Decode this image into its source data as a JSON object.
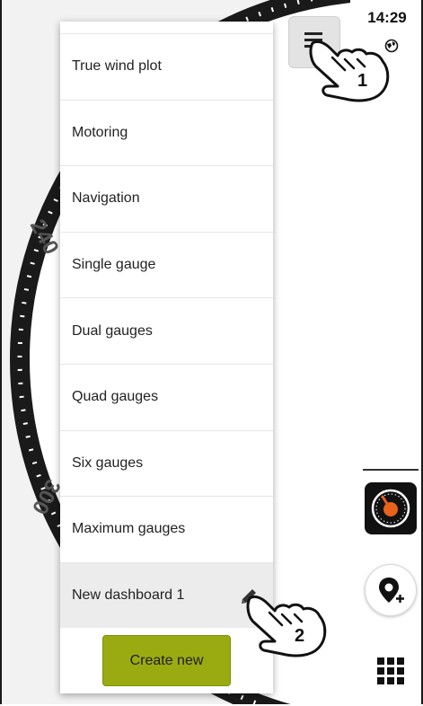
{
  "status_bar": {
    "time": "14:29"
  },
  "background_gauge": {
    "tick_label_a": "240",
    "tick_label_b": "300"
  },
  "menu": {
    "items": [
      {
        "label": "True wind plot"
      },
      {
        "label": "Motoring"
      },
      {
        "label": "Navigation"
      },
      {
        "label": "Single gauge"
      },
      {
        "label": "Dual gauges"
      },
      {
        "label": "Quad gauges"
      },
      {
        "label": "Six gauges"
      },
      {
        "label": "Maximum gauges"
      },
      {
        "label": "New dashboard 1",
        "selected": true
      }
    ],
    "create_button_label": "Create new"
  },
  "callouts": {
    "step_1": "1",
    "step_2": "2"
  },
  "colors": {
    "create_button": "#9aab12",
    "app_tile_accent": "#e8621c",
    "menu_selected": "#ececec"
  }
}
